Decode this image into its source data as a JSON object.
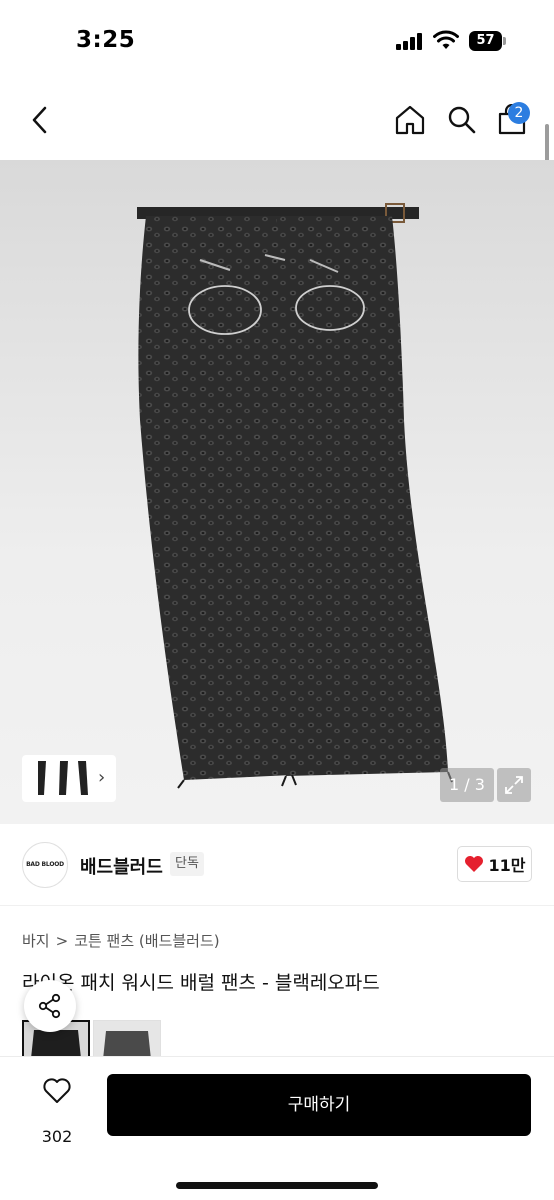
{
  "status": {
    "time": "3:25",
    "battery": "57"
  },
  "nav": {
    "cart_count": "2"
  },
  "gallery": {
    "page_indicator": "1 / 3",
    "current_page": 1,
    "total_pages": 3
  },
  "brand": {
    "logo_text": "BAD BLOOD",
    "name": "배드블러드",
    "exclusive_label": "단독",
    "likes": "11만"
  },
  "breadcrumb": {
    "category": "바지",
    "separator": ">",
    "subcategory": "코튼 팬츠 (배드블러드)"
  },
  "product": {
    "title": "라이온 패치 워시드 배럴 팬츠 - 블랙레오파드"
  },
  "bottom_bar": {
    "wish_count": "302",
    "buy_label": "구매하기"
  },
  "colors": {
    "accent": "#2c7de0",
    "heart": "#e5202e",
    "buy_button": "#000000"
  },
  "icons": [
    "back-icon",
    "home-icon",
    "search-icon",
    "shopping-bag-icon",
    "expand-icon",
    "heart-icon",
    "share-icon"
  ]
}
